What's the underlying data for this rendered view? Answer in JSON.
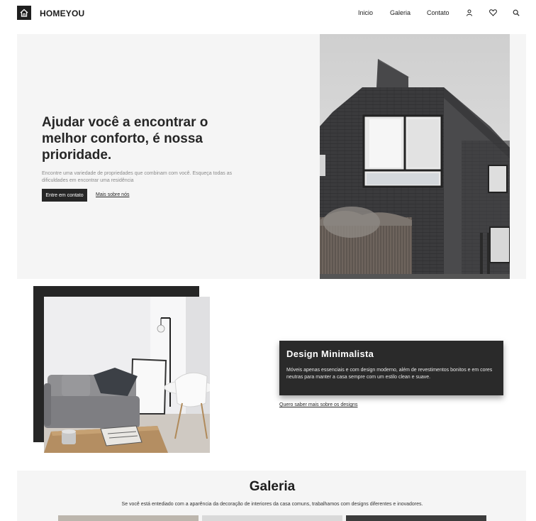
{
  "header": {
    "brand": "HOMEYOU",
    "nav": [
      {
        "label": "Inicio"
      },
      {
        "label": "Galeria"
      },
      {
        "label": "Contato"
      }
    ],
    "icons": [
      "user-icon",
      "heart-icon",
      "search-icon"
    ]
  },
  "hero": {
    "title": "Ajudar você a encontrar o melhor conforto, é nossa prioridade.",
    "description": "Encontre uma variedade de propriedades que combinam com você. Esqueça todas as dificuldades em encontrar uma residência",
    "primary_button": "Entre em contato",
    "secondary_link": "Mais sobre nós"
  },
  "feature": {
    "title": "Design Minimalista",
    "text": "Móveis apenas essenciais e com design moderno, além de revestimentos bonitos e em cores neutras para manter a casa sempre com um estilo clean e suave.",
    "link": "Quero saber mais sobre os designs"
  },
  "gallery": {
    "title": "Galeria",
    "description": "Se você está entediado com a aparência da decoração de interiores da casa comuns, trabalhamos com designs diferentes e inovadores."
  },
  "colors": {
    "dark": "#262626",
    "hero_bg": "#f5f5f5"
  }
}
